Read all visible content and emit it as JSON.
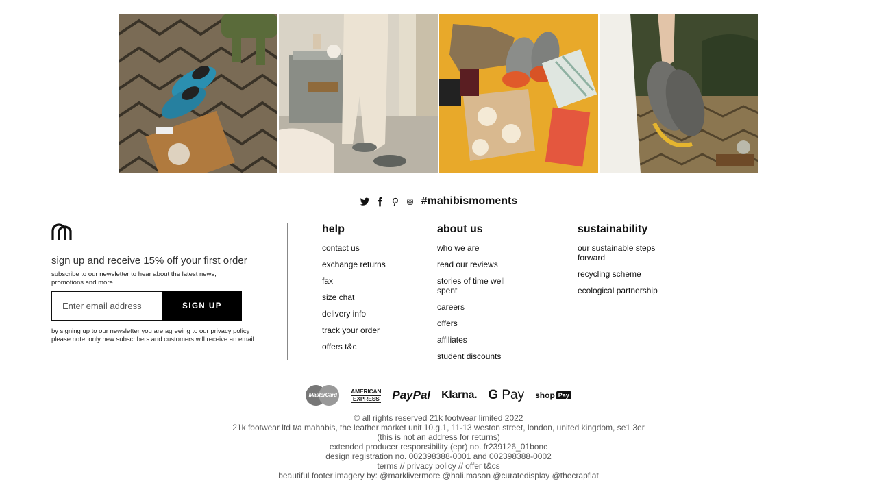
{
  "gallery": {
    "tiles": [
      {
        "alt_name": "blue-slippers-on-rug"
      },
      {
        "alt_name": "person-walking-in-slippers"
      },
      {
        "alt_name": "flatlay-grey-slippers"
      },
      {
        "alt_name": "hand-holding-slippers"
      }
    ]
  },
  "social": {
    "hashtag": "#mahibismoments",
    "icons": [
      "twitter-icon",
      "facebook-icon",
      "pinterest-icon",
      "instagram-icon"
    ]
  },
  "newsletter": {
    "title": "sign up and receive 15% off your first order",
    "subtitle": "subscribe to our newsletter to hear about the latest news, promotions and more",
    "email_placeholder": "Enter email address",
    "signup_label": "SIGN UP",
    "legal_line1": "by signing up to our newsletter you are agreeing to our privacy policy",
    "legal_line2": "please note: only new subscribers and customers will receive an email"
  },
  "columns": {
    "help": {
      "heading": "help",
      "links": [
        "contact us",
        "exchange returns",
        "fax",
        "size chat",
        "delivery info",
        "track your order",
        "offers t&c"
      ]
    },
    "about": {
      "heading": "about us",
      "links": [
        "who we are",
        "read our reviews",
        "stories of time well spent",
        "careers",
        "offers",
        "affiliates",
        "student discounts"
      ]
    },
    "sustainability": {
      "heading": "sustainability",
      "links": [
        "our sustainable steps forward",
        "recycling scheme",
        "ecological partnership"
      ]
    }
  },
  "payments": {
    "mastercard": "MasterCard",
    "amex_line1": "AMERICAN",
    "amex_line2": "EXPRESS",
    "paypal": "PayPal",
    "klarna": "Klarna.",
    "gpay_g": "G",
    "gpay_pay": "Pay",
    "shop": "shop",
    "shop_pay": "Pay"
  },
  "legal": {
    "copyright": "© all rights reserved 21k footwear limited 2022",
    "address": "21k footwear ltd t/a mahabis, the leather market unit 10.g.1, 11-13 weston street, london, united kingdom, se1 3er",
    "not_returns": "(this is not an address for returns)",
    "epr": "extended producer responsibility (epr) no. fr239126_01bonc",
    "design_reg": "design registration no. 002398388-0001 and 002398388-0002",
    "terms": "terms",
    "sep1": " // ",
    "privacy": "privacy policy",
    "sep2": " // ",
    "offer_tcs": "offer t&cs",
    "credits": "beautiful footer imagery by: @marklivermore @hali.mason @curatedisplay @thecrapflat"
  }
}
